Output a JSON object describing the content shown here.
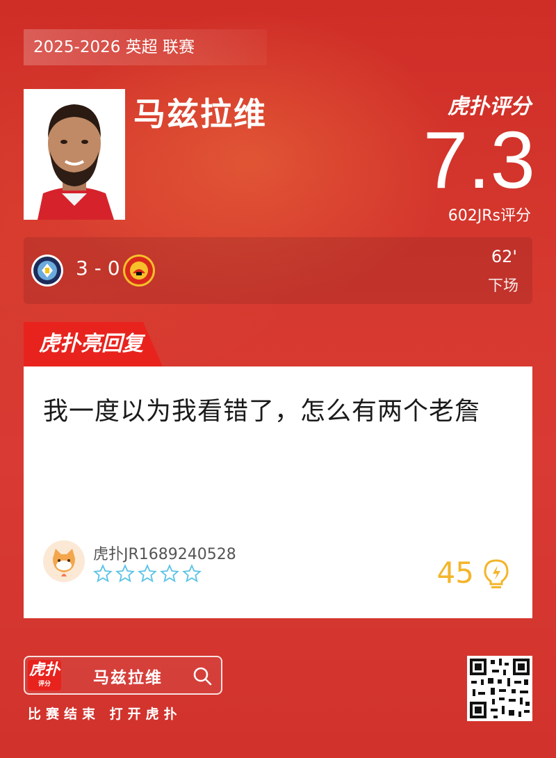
{
  "header": {
    "season": "2025-2026 英超 联赛",
    "player_name": "马兹拉维",
    "brand": "虎扑评分",
    "rating": "7.3",
    "rating_count": "602JRs评分"
  },
  "match": {
    "result": "3 - 0",
    "minute": "62'",
    "status": "下场"
  },
  "reply": {
    "tab_label": "虎扑亮回复",
    "text": "我一度以为我看错了，怎么有两个老詹",
    "username": "虎扑JR1689240528",
    "stars_filled": 0,
    "stars_total": 5,
    "likes": "45"
  },
  "footer": {
    "search_logo": "虎扑",
    "search_logo_sub": "评分",
    "search_term": "马兹拉维",
    "tagline": "比赛结束 打开虎扑"
  },
  "colors": {
    "background": "#d3332c",
    "accent": "#e8231e",
    "likes": "#f3b52b",
    "stars": "#5cc3e6"
  }
}
